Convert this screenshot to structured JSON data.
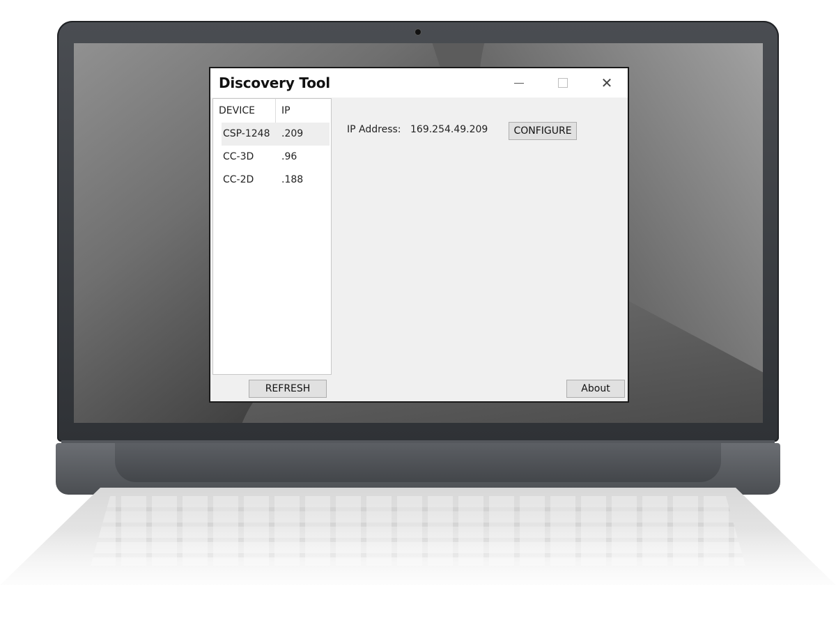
{
  "window": {
    "title": "Discovery Tool",
    "controls": {
      "minimize_icon": "minimize-icon",
      "maximize_icon": "maximize-icon",
      "close_icon": "close-icon",
      "close_glyph": "✕"
    }
  },
  "device_list": {
    "columns": [
      "DEVICE",
      "IP"
    ],
    "rows": [
      {
        "device": "CSP-1248",
        "ip": ".209",
        "selected": true
      },
      {
        "device": "CC-3D",
        "ip": ".96",
        "selected": false
      },
      {
        "device": "CC-2D",
        "ip": ".188",
        "selected": false
      }
    ]
  },
  "details": {
    "ip_label": "IP Address:",
    "ip_value": "169.254.49.209",
    "configure_label": "CONFIGURE"
  },
  "footer": {
    "refresh_label": "REFRESH",
    "about_label": "About"
  },
  "colors": {
    "window_bg": "#f0f0f0",
    "titlebar_bg": "#ffffff",
    "button_bg": "#e1e1e1",
    "selected_row_bg": "#eeeeee"
  }
}
